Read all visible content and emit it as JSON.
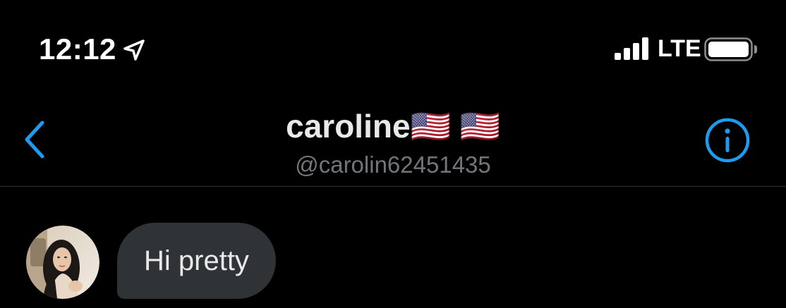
{
  "status_bar": {
    "time": "12:12",
    "network": "LTE",
    "icons": [
      "location-arrow-icon",
      "cellular-signal-icon",
      "battery-icon"
    ]
  },
  "header": {
    "contact_name": "caroline🇺🇸 🇺🇸",
    "contact_handle": "@carolin62451435",
    "back_icon": "chevron-left-icon",
    "info_icon": "info-circle-icon"
  },
  "messages": [
    {
      "direction": "incoming",
      "text": "Hi pretty",
      "has_avatar": true
    }
  ],
  "colors": {
    "background": "#000000",
    "accent": "#1d9bf0",
    "bubble_incoming": "#2f3336",
    "handle_text": "#71767b",
    "divider": "#2f3336"
  }
}
